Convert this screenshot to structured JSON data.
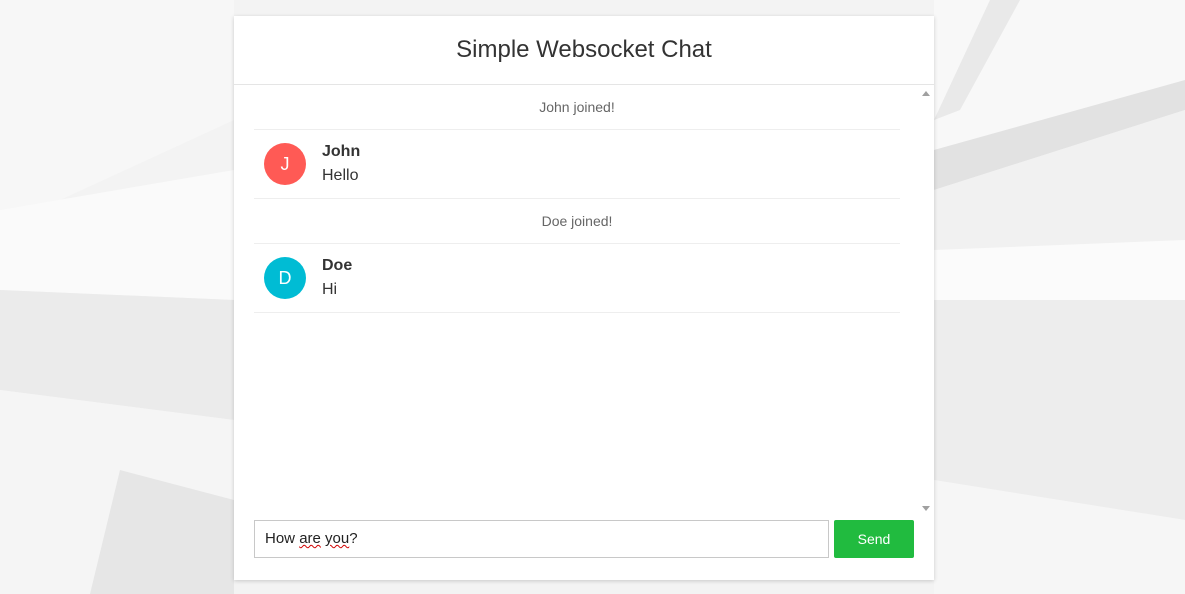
{
  "header": {
    "title": "Simple Websocket Chat"
  },
  "messages": [
    {
      "kind": "system",
      "text": "John joined!"
    },
    {
      "kind": "chat",
      "initial": "J",
      "author": "John",
      "text": "Hello",
      "avatar_color": "#ff5a55"
    },
    {
      "kind": "system",
      "text": "Doe joined!"
    },
    {
      "kind": "chat",
      "initial": "D",
      "author": "Doe",
      "text": "Hi",
      "avatar_color": "#00bcd4"
    }
  ],
  "composer": {
    "value_parts": [
      "How ",
      "are",
      " ",
      "you",
      "?"
    ],
    "send_label": "Send",
    "send_color": "#21bb3f"
  },
  "icons": {
    "scroll_up": "scroll-up-arrow-icon",
    "scroll_down": "scroll-down-arrow-icon"
  }
}
